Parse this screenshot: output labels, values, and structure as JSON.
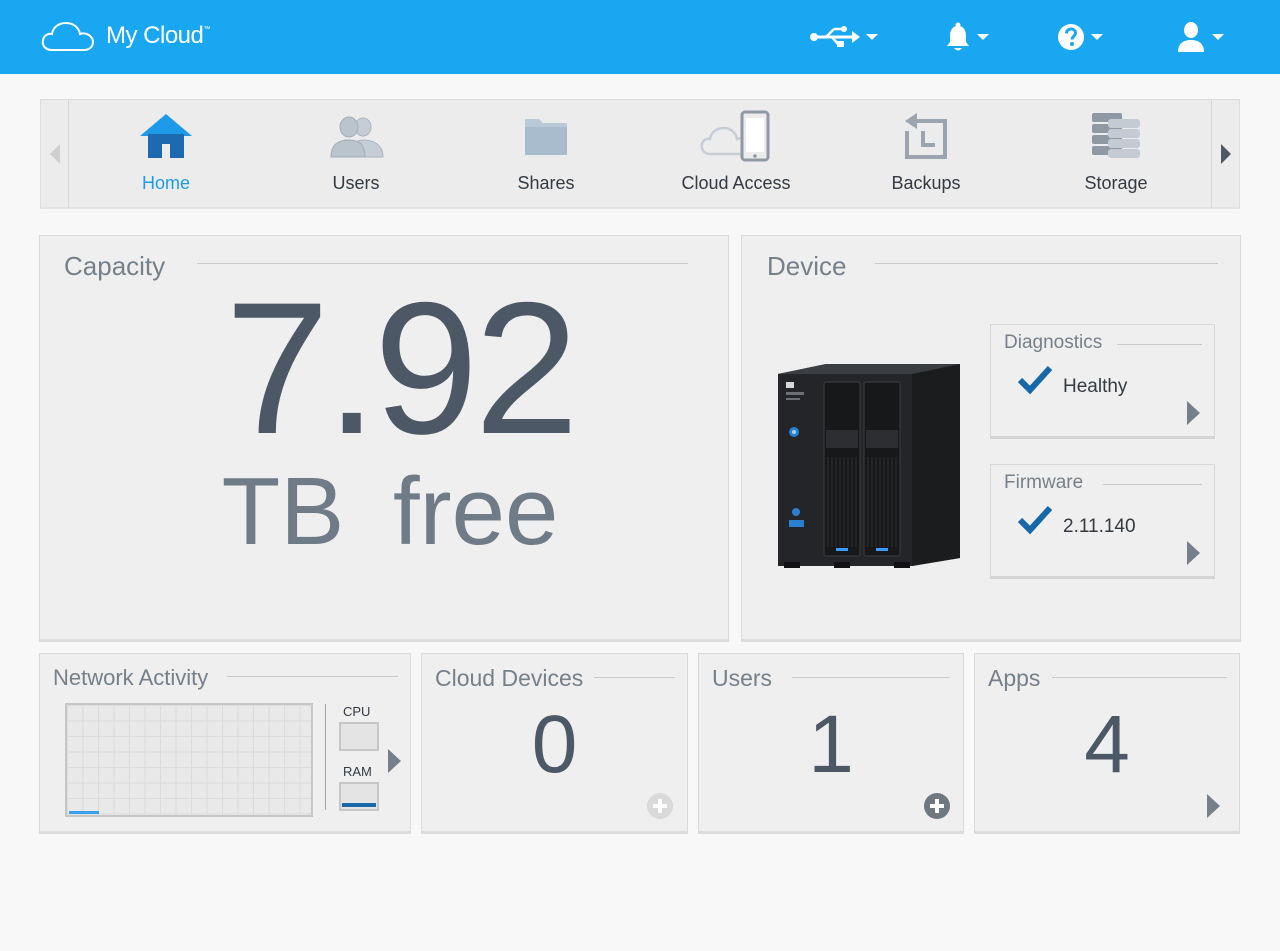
{
  "app": {
    "title": "My Cloud",
    "trademark": "™",
    "accent": "#1aa7f2"
  },
  "header": {
    "icons": [
      "usb-icon",
      "bell-icon",
      "help-icon",
      "user-icon"
    ]
  },
  "nav": {
    "items": [
      {
        "label": "Home",
        "icon": "home-icon",
        "active": true
      },
      {
        "label": "Users",
        "icon": "users-icon",
        "active": false
      },
      {
        "label": "Shares",
        "icon": "folder-icon",
        "active": false
      },
      {
        "label": "Cloud Access",
        "icon": "cloud-phone-icon",
        "active": false
      },
      {
        "label": "Backups",
        "icon": "backup-icon",
        "active": false
      },
      {
        "label": "Storage",
        "icon": "storage-icon",
        "active": false
      }
    ]
  },
  "capacity": {
    "title": "Capacity",
    "value": "7.92",
    "unit": "TB  free"
  },
  "device": {
    "title": "Device",
    "diagnostics": {
      "title": "Diagnostics",
      "value": "Healthy"
    },
    "firmware": {
      "title": "Firmware",
      "value": "2.11.140"
    }
  },
  "network": {
    "title": "Network Activity",
    "cpu_label": "CPU",
    "ram_label": "RAM"
  },
  "cloud_devices": {
    "title": "Cloud Devices",
    "count": "0"
  },
  "users": {
    "title": "Users",
    "count": "1"
  },
  "apps": {
    "title": "Apps",
    "count": "4"
  },
  "colors": {
    "check": "#1668a8",
    "ram_fill": "#1668a8",
    "graph_line": "#3aa0e8"
  }
}
